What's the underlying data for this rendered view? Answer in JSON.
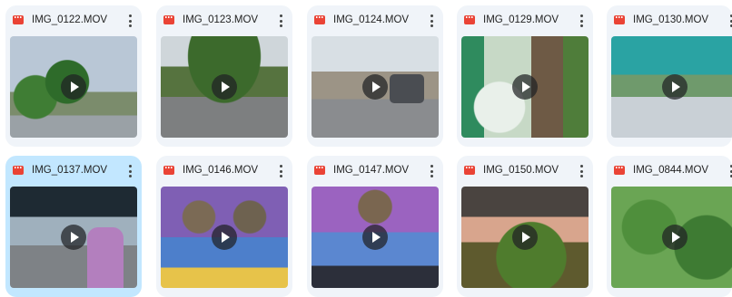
{
  "files": [
    {
      "name": "IMG_0122.MOV",
      "selected": false
    },
    {
      "name": "IMG_0123.MOV",
      "selected": false
    },
    {
      "name": "IMG_0124.MOV",
      "selected": false
    },
    {
      "name": "IMG_0129.MOV",
      "selected": false
    },
    {
      "name": "IMG_0130.MOV",
      "selected": false
    },
    {
      "name": "IMG_0137.MOV",
      "selected": true
    },
    {
      "name": "IMG_0146.MOV",
      "selected": false
    },
    {
      "name": "IMG_0147.MOV",
      "selected": false
    },
    {
      "name": "IMG_0150.MOV",
      "selected": false
    },
    {
      "name": "IMG_0844.MOV",
      "selected": false
    }
  ],
  "icons": {
    "file_type": "video-file-icon",
    "menu": "more-vert-icon",
    "overlay": "play-icon"
  },
  "colors": {
    "card_background": "#f0f4f9",
    "card_selected_background": "#c2e7ff",
    "video_icon": "#ea4335"
  }
}
